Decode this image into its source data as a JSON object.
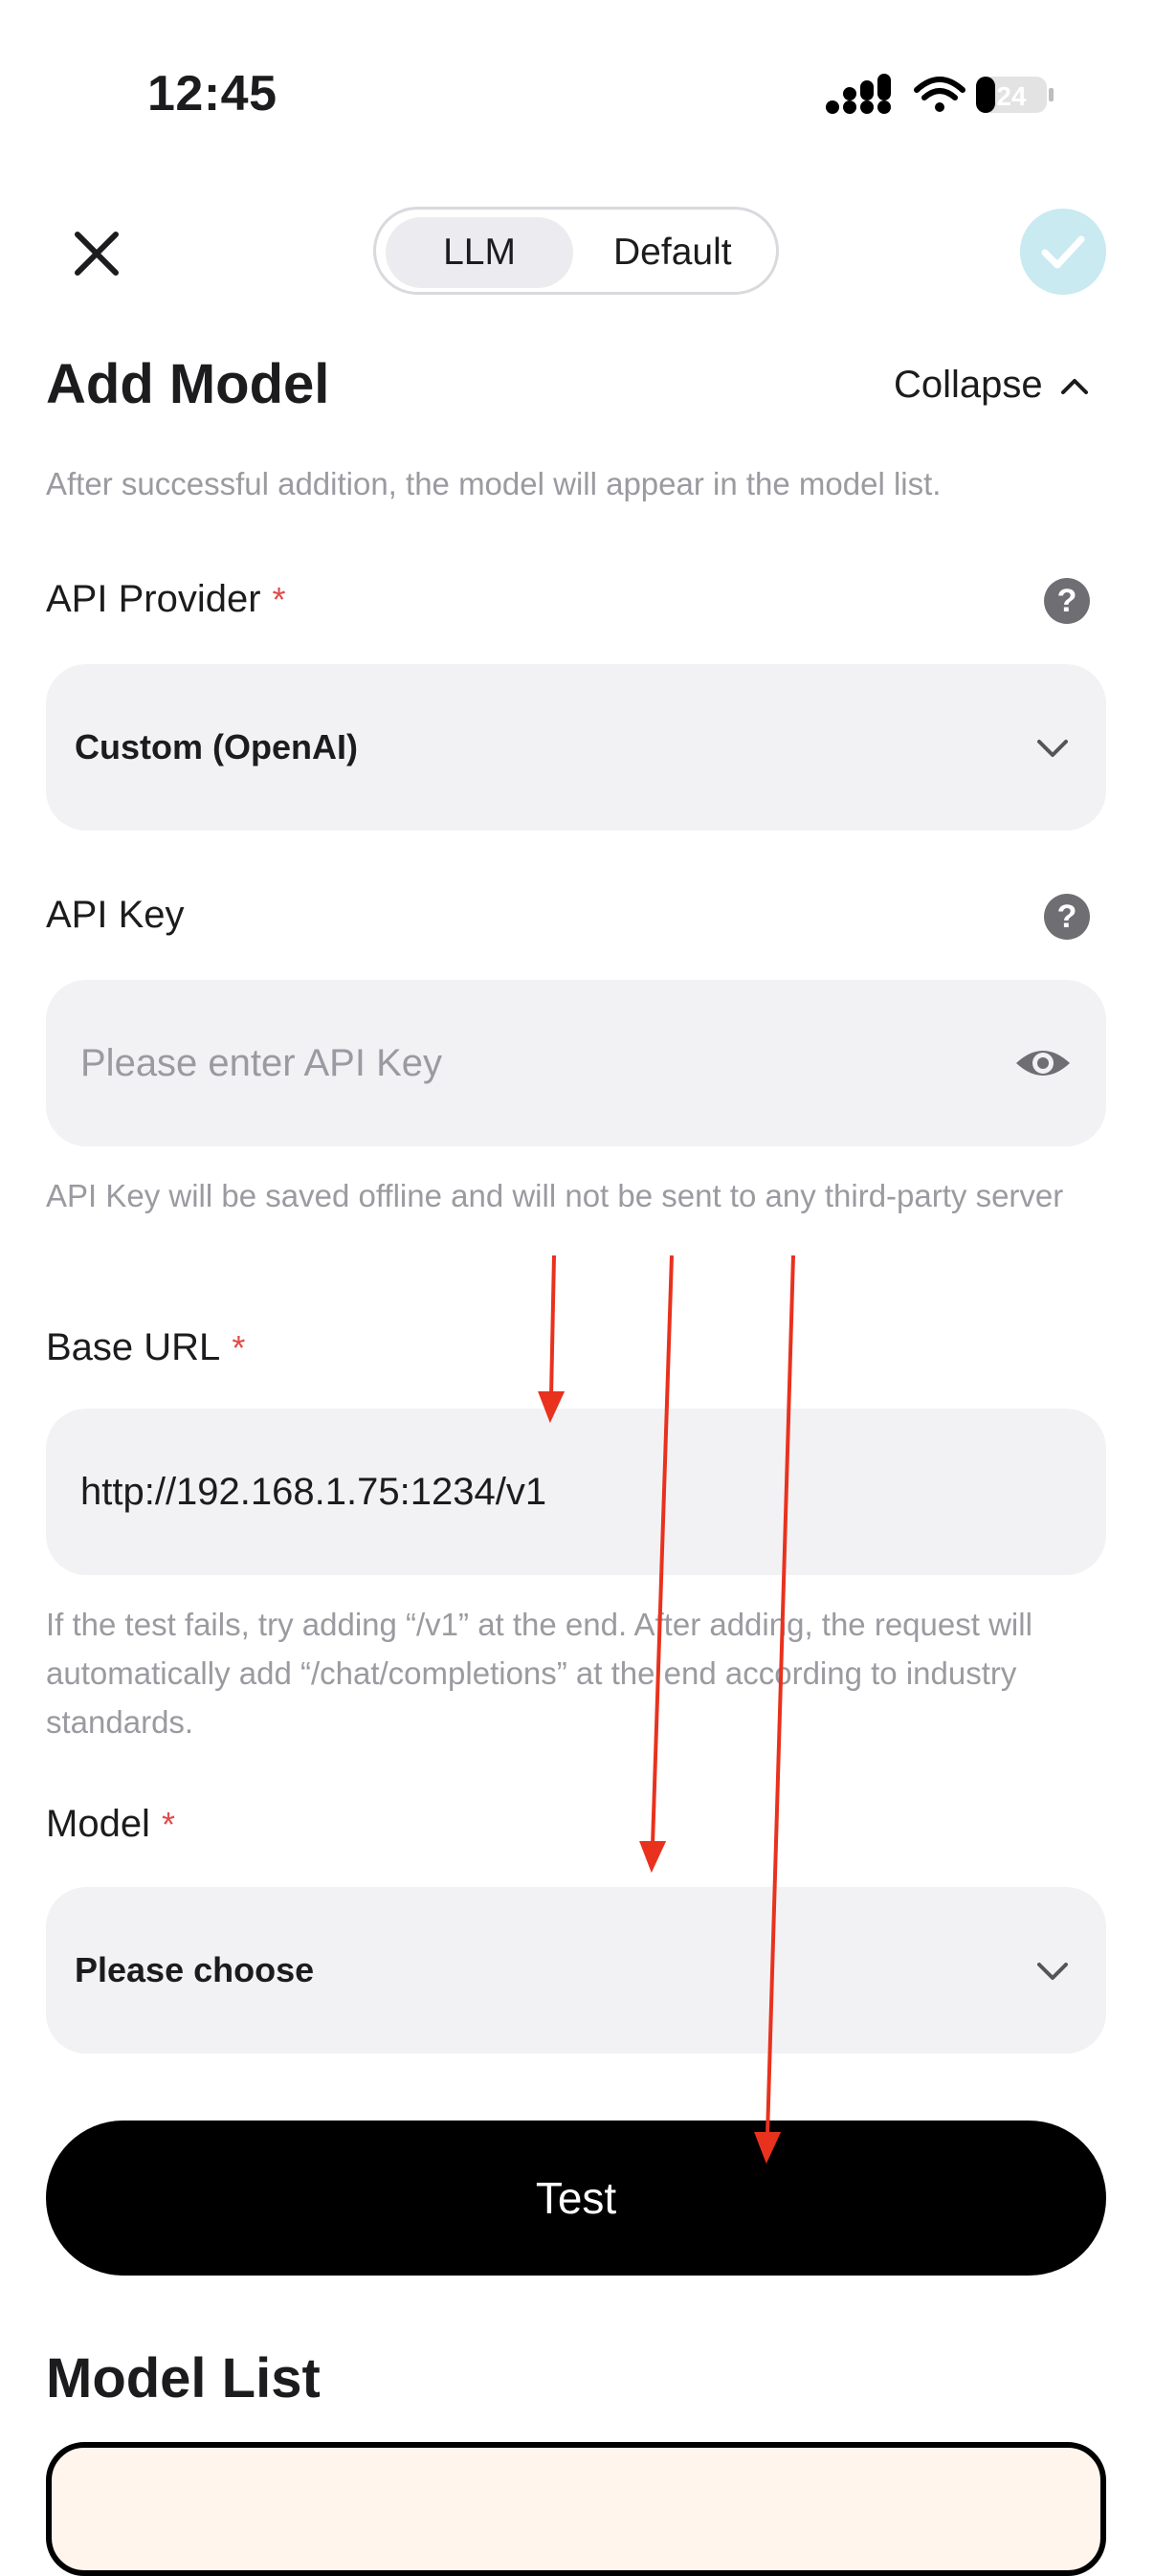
{
  "status_bar": {
    "time": "12:45",
    "battery": "24"
  },
  "top_bar": {
    "tabs": [
      "LLM",
      "Default"
    ]
  },
  "add_model": {
    "title": "Add Model",
    "collapse_label": "Collapse",
    "description": "After successful addition, the model will appear in the model list."
  },
  "api_provider": {
    "label": "API Provider",
    "required": "*",
    "help": "?",
    "value": "Custom (OpenAI)"
  },
  "api_key": {
    "label": "API Key",
    "help": "?",
    "placeholder": "Please enter API Key",
    "note": "API Key will be saved offline and will not be sent to any third-party server"
  },
  "base_url": {
    "label": "Base URL",
    "required": "*",
    "value": "http://192.168.1.75:1234/v1",
    "note": "If the test fails, try adding “/v1” at the end. After adding, the request will automatically add “/chat/completions” at the end according to industry standards."
  },
  "model": {
    "label": "Model",
    "required": "*",
    "value": "Please choose"
  },
  "test_button": "Test",
  "model_list": {
    "title": "Model List"
  },
  "colors": {
    "accent_disabled": "#c8eaf0",
    "required": "#e24a4a",
    "annotation": "#e8321e",
    "button": "#000000"
  }
}
